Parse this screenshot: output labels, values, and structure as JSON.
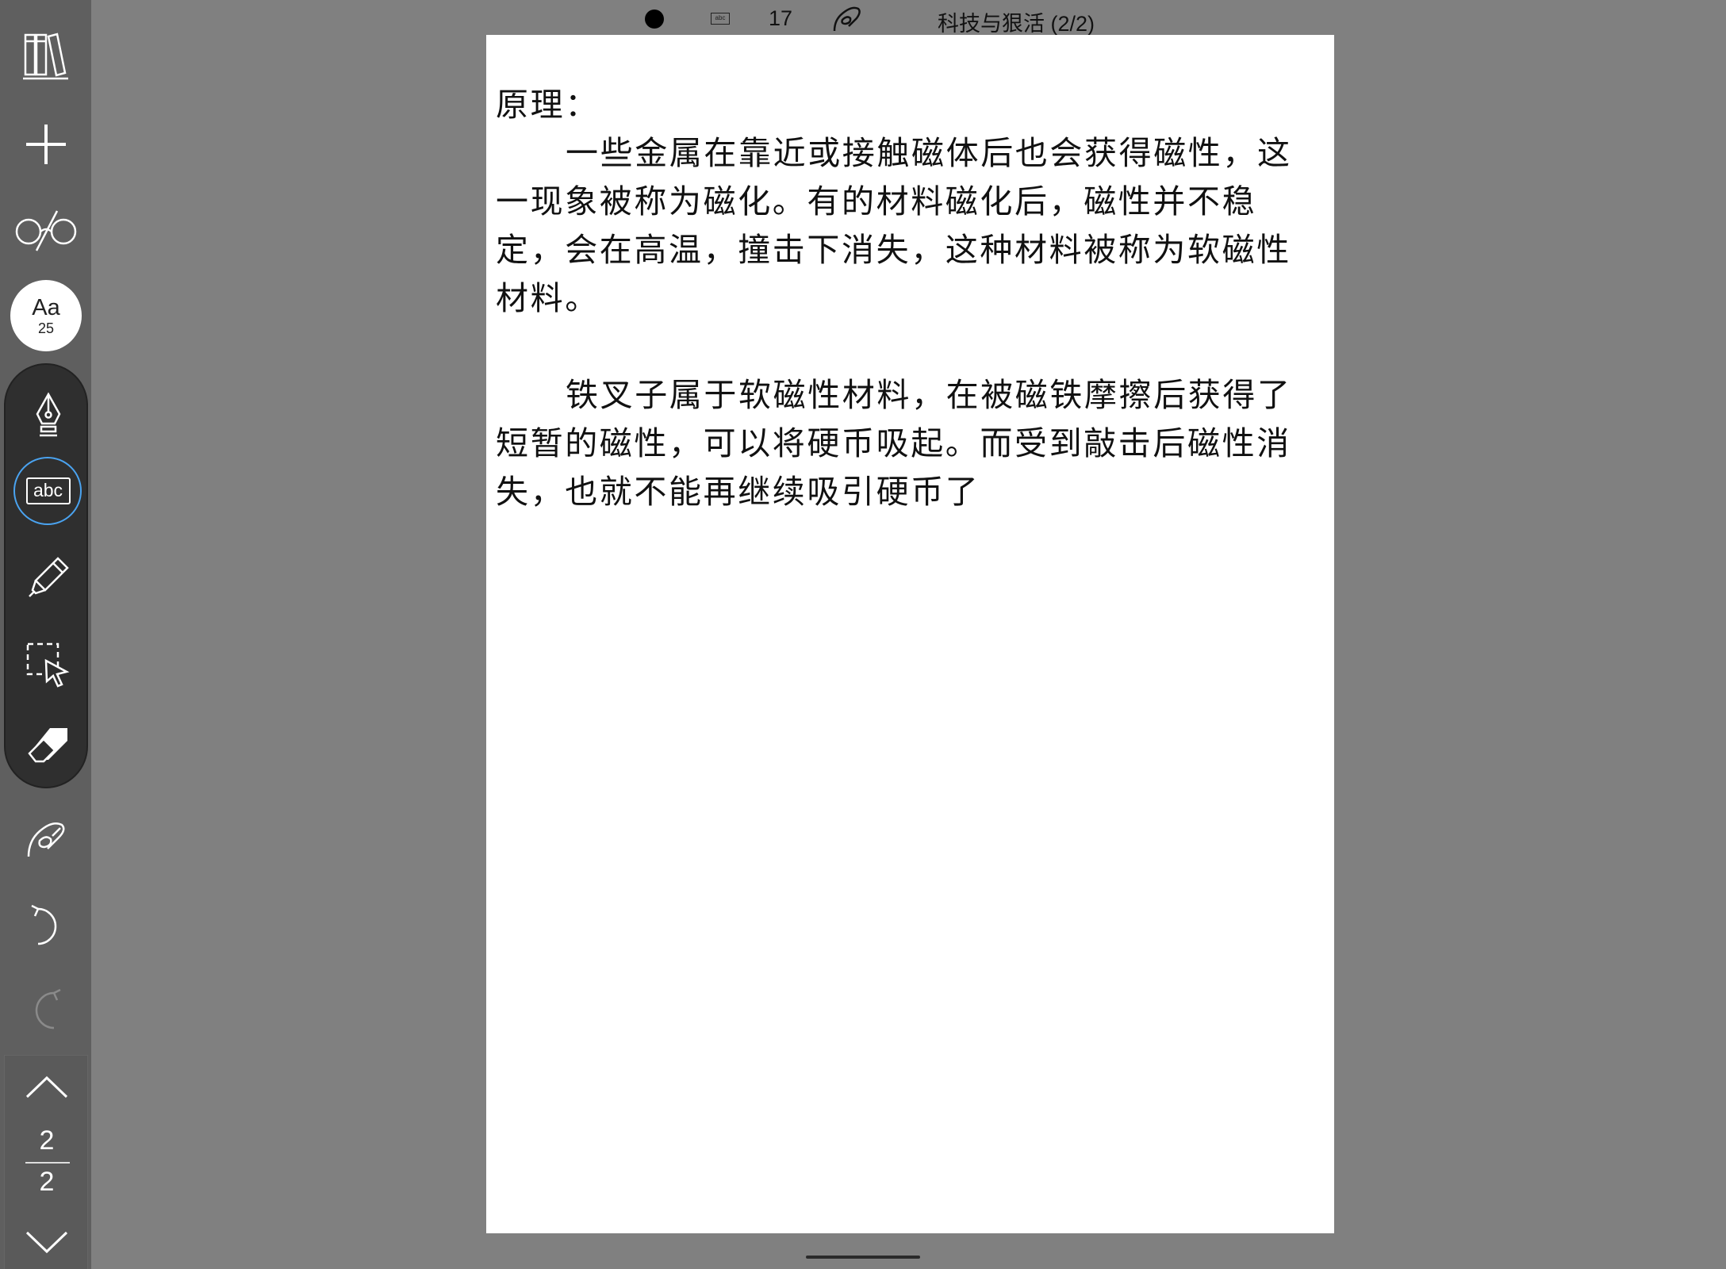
{
  "status_bar": {
    "brush_color": "#000000",
    "word_count": "17",
    "document_title": "科技与狠活 (2/2)"
  },
  "toolbar": {
    "items": [
      {
        "name": "library-icon"
      },
      {
        "name": "add-icon"
      },
      {
        "name": "glasses-icon"
      },
      {
        "name": "font-size",
        "label": "Aa",
        "size": "25"
      },
      {
        "name": "pen-icon"
      },
      {
        "name": "text-tool-icon",
        "label": "abc",
        "selected": true
      },
      {
        "name": "highlighter-icon"
      },
      {
        "name": "lasso-select-icon"
      },
      {
        "name": "eraser-icon"
      },
      {
        "name": "lasso-hand-icon"
      },
      {
        "name": "undo-icon"
      },
      {
        "name": "redo-icon",
        "enabled": false
      }
    ],
    "accent_color": "#4aa3f0"
  },
  "page_nav": {
    "current_page": "2",
    "total_pages": "2"
  },
  "document": {
    "heading": "原理：",
    "paragraph1": "一些金属在靠近或接触磁体后也会获得磁性，这一现象被称为磁化。有的材料磁化后，磁性并不稳定，会在高温，撞击下消失，这种材料被称为软磁性材料。",
    "paragraph2": "铁叉子属于软磁性材料，在被磁铁摩擦后获得了短暂的磁性，可以将硬币吸起。而受到敲击后磁性消失，也就不能再继续吸引硬币了"
  }
}
